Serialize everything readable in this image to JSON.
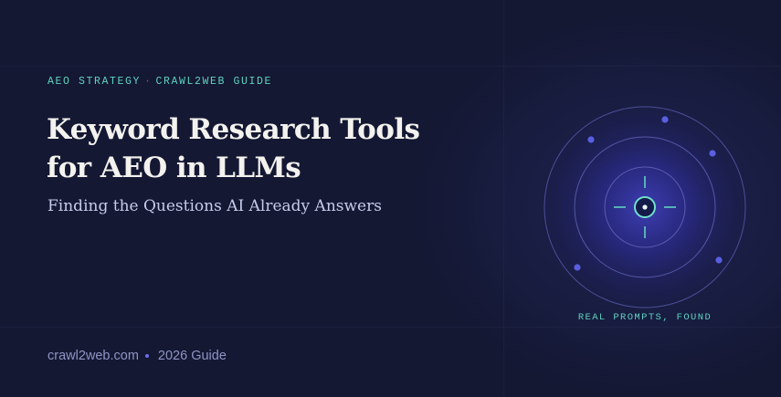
{
  "header": {
    "eyebrow_left": "AEO STRATEGY",
    "eyebrow_separator": "·",
    "eyebrow_right": "CRAWL2WEB GUIDE"
  },
  "hero": {
    "title_line1": "Keyword Research Tools",
    "title_line2": "for AEO in LLMs",
    "subtitle": "Finding the Questions AI Already Answers"
  },
  "illustration": {
    "icon": "target-crosshair-icon",
    "caption": "REAL PROMPTS, FOUND"
  },
  "footer": {
    "site": "crawl2web.com",
    "edition": "2026 Guide"
  },
  "colors": {
    "background": "#141833",
    "accent_teal": "#5fd3c0",
    "accent_indigo": "#5a5fe0",
    "title_text": "#f4f2ee",
    "subtitle_text": "#c7cbe9",
    "footer_text": "#8f95c4"
  }
}
